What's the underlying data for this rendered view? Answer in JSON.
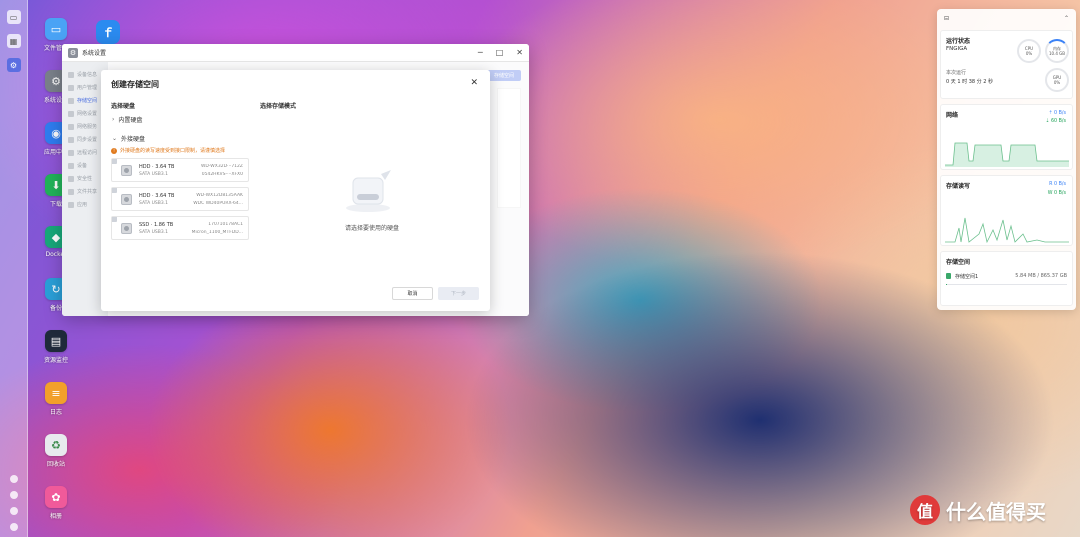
{
  "desktop": {
    "icons": [
      {
        "label": "文件管理",
        "color": "#4aa3f5",
        "glyph": "▭"
      },
      {
        "label": "系统设置",
        "color": "#7a808a",
        "glyph": "⚙"
      },
      {
        "label": "应用中心",
        "color": "#2f7df0",
        "glyph": "◉"
      },
      {
        "label": "下载",
        "color": "#21b35a",
        "glyph": "⬇"
      },
      {
        "label": "Docker",
        "color": "#18a87a",
        "glyph": "◆"
      },
      {
        "label": "备份",
        "color": "#2a9fd8",
        "glyph": "↻"
      },
      {
        "label": "资源监控",
        "color": "#1f2a3a",
        "glyph": "▤"
      },
      {
        "label": "日志",
        "color": "#f2a02a",
        "glyph": "≡"
      },
      {
        "label": "回收站",
        "color": "#e8eaee",
        "glyph": "♻"
      },
      {
        "label": "相册",
        "color": "#f05a9a",
        "glyph": "✿"
      }
    ]
  },
  "settings_window": {
    "title": "系统设置",
    "controls": {
      "minimize": "─",
      "maximize": "□",
      "close": "✕"
    },
    "sidebar": [
      "设备信息",
      "用户管理",
      "存储空间",
      "网络设置",
      "网络服务",
      "同步设置",
      "远程访问",
      "设备",
      "安全性",
      "文件共享",
      "应用"
    ],
    "top_button": "存储空间"
  },
  "dialog": {
    "title": "创建存储空间",
    "close": "✕",
    "select_disk_label": "选择硬盘",
    "select_mode_label": "选择存储模式",
    "internal_group": "内置硬盘",
    "external_group": "外接硬盘",
    "warning": "外接硬盘的读写速度受到接口限制，请谨慎选择",
    "disks": [
      {
        "name": "HDD · 3.64 TB",
        "sub": "SATA USB3.1",
        "model": "WD-WX32D···712Z",
        "model2": "0542HKVS-···XFX0"
      },
      {
        "name": "HDD · 3.64 TB",
        "sub": "SATA USB3.1",
        "model": "WD-WX12D8135AAK",
        "model2": "WDC WD40PURX-64..."
      },
      {
        "name": "SSD · 1.86 TB",
        "sub": "SATA USB3.1",
        "model": "170710178AC1",
        "model2": "Micron_1100_MTFDD..."
      }
    ],
    "empty_hint": "请选择要使用的硬盘",
    "cancel_label": "取消",
    "next_label": "下一步"
  },
  "panel": {
    "status": {
      "title": "运行状态",
      "host": "FNGIGA",
      "cpu_label": "CPU",
      "cpu_value": "0%",
      "mem_label": "内存",
      "mem_value": "10.4 GB",
      "gpu_label": "GPU",
      "gpu_value": "0%",
      "uptime_label": "本次运行",
      "uptime_value": "0 天 1 时 38 分 2 秒"
    },
    "network": {
      "title": "网络",
      "up": "0 B/s",
      "down": "60 B/s"
    },
    "disk_io": {
      "title": "存储读写",
      "read": "R 0 B/s",
      "write": "W 0 B/s"
    },
    "storage": {
      "title": "存储空间",
      "name": "存储空间1",
      "size": "5.84 MB / 865.37 GB",
      "used_fraction": 0.001
    }
  },
  "watermark": {
    "logo": "值",
    "text": "什么值得买"
  }
}
